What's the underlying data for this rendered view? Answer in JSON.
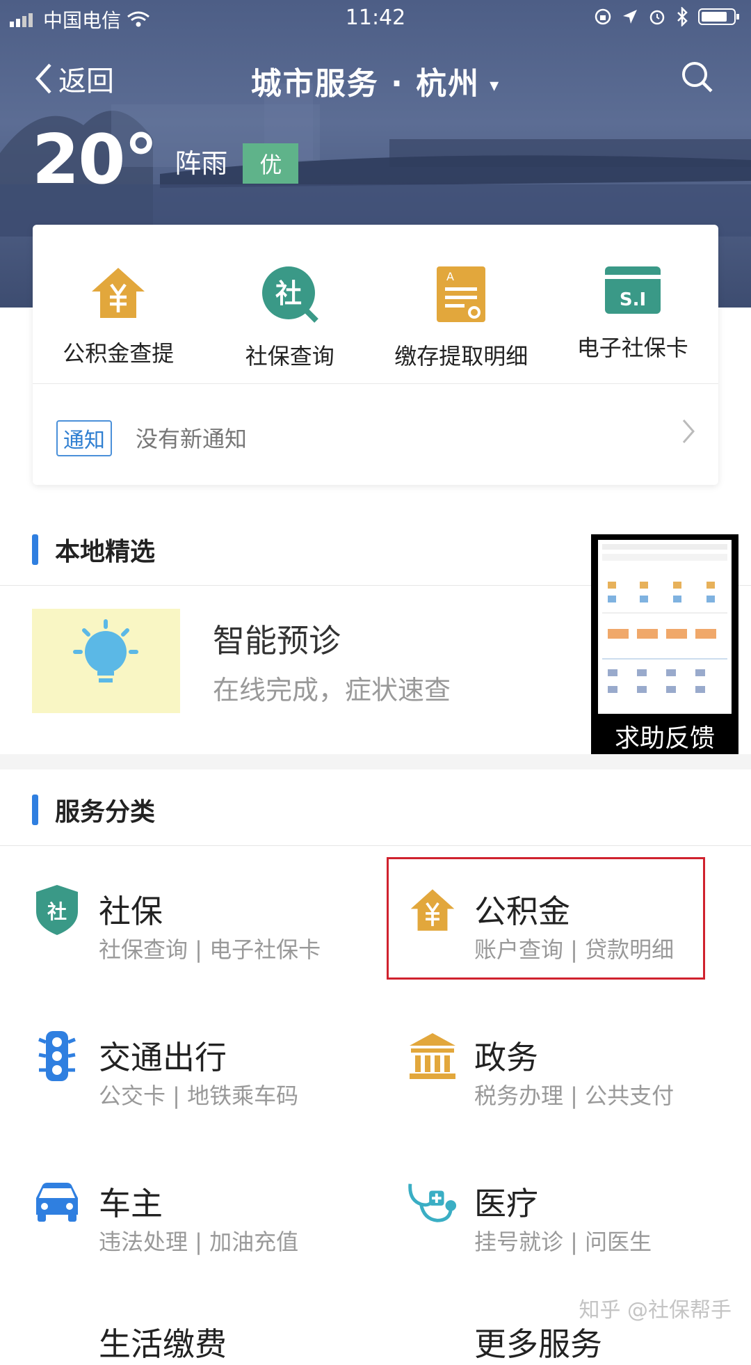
{
  "status_bar": {
    "carrier": "中国电信",
    "time": "11:42"
  },
  "nav": {
    "back_label": "返回",
    "title": "城市服务 · 杭州",
    "caret": "▾"
  },
  "weather": {
    "temperature": "20°",
    "condition": "阵雨",
    "aqi": "优"
  },
  "quick_actions": [
    {
      "label": "公积金查提",
      "icon": "house-yuan-icon"
    },
    {
      "label": "社保查询",
      "icon": "social-security-search-icon"
    },
    {
      "label": "缴存提取明细",
      "icon": "document-icon"
    },
    {
      "label": "电子社保卡",
      "icon": "si-card-icon"
    }
  ],
  "notice": {
    "tag": "通知",
    "text": "没有新通知"
  },
  "local_section": {
    "title": "本地精选",
    "featured": {
      "title": "智能预诊",
      "subtitle": "在线完成，症状速查"
    }
  },
  "feedback_thumb": {
    "label": "求助反馈"
  },
  "category_section": {
    "title": "服务分类",
    "items": [
      {
        "title": "社保",
        "subtitle": "社保查询 | 电子社保卡",
        "icon": "shield-icon"
      },
      {
        "title": "公积金",
        "subtitle": "账户查询 | 贷款明细",
        "icon": "house-yuan-icon"
      },
      {
        "title": "交通出行",
        "subtitle": "公交卡 | 地铁乘车码",
        "icon": "traffic-light-icon"
      },
      {
        "title": "政务",
        "subtitle": "税务办理 | 公共支付",
        "icon": "government-building-icon"
      },
      {
        "title": "车主",
        "subtitle": "违法处理 | 加油充值",
        "icon": "car-icon"
      },
      {
        "title": "医疗",
        "subtitle": "挂号就诊 | 问医生",
        "icon": "stethoscope-icon"
      }
    ],
    "partial_left": "生活缴费",
    "partial_right": "更多服务"
  },
  "watermark": "知乎 @社保帮手",
  "colors": {
    "accent_blue": "#2f7fe0",
    "gold": "#e2a73c",
    "teal": "#3a9987",
    "highlight_red": "#d0222e",
    "aqi_green": "#5fb38a"
  }
}
